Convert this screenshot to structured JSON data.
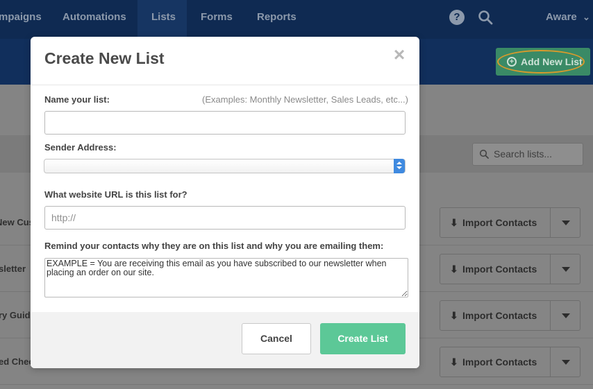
{
  "nav": {
    "items": [
      {
        "label": "mpaigns",
        "active": false
      },
      {
        "label": "Automations",
        "active": false
      },
      {
        "label": "Lists",
        "active": true
      },
      {
        "label": "Forms",
        "active": false
      },
      {
        "label": "Reports",
        "active": false
      }
    ],
    "account_label": "Aware",
    "help_glyph": "?",
    "account_caret": "⌄"
  },
  "toolbar": {
    "add_new_list_label": "Add New List",
    "add_new_list_icon": "plus-circle-icon"
  },
  "lists_table": {
    "search_placeholder": "Search lists...",
    "column_partial": "s",
    "rows": [
      {
        "name": "New Cus",
        "import_label": "Import Contacts"
      },
      {
        "name": "sletter",
        "import_label": "Import Contacts"
      },
      {
        "name": "ry Guid",
        "import_label": "Import Contacts"
      },
      {
        "name": "ed Chec",
        "import_label": "Import Contacts"
      }
    ]
  },
  "modal": {
    "title": "Create New List",
    "close_glyph": "×",
    "name_label": "Name your list:",
    "name_hint": "(Examples: Monthly Newsletter, Sales Leads, etc...)",
    "name_value": "",
    "sender_label": "Sender Address:",
    "sender_value": "",
    "url_label": "What website URL is this list for?",
    "url_placeholder": "http://",
    "remind_label": "Remind your contacts why they are on this list and why you are emailing them:",
    "remind_value": "EXAMPLE = You are receiving this email as you have subscribed to our newsletter when placing an order on our site.",
    "cancel_label": "Cancel",
    "create_label": "Create List"
  },
  "colors": {
    "nav_bg": "#0f2a52",
    "primary_green": "#5cc897",
    "highlight_ring": "#d89a2c"
  }
}
